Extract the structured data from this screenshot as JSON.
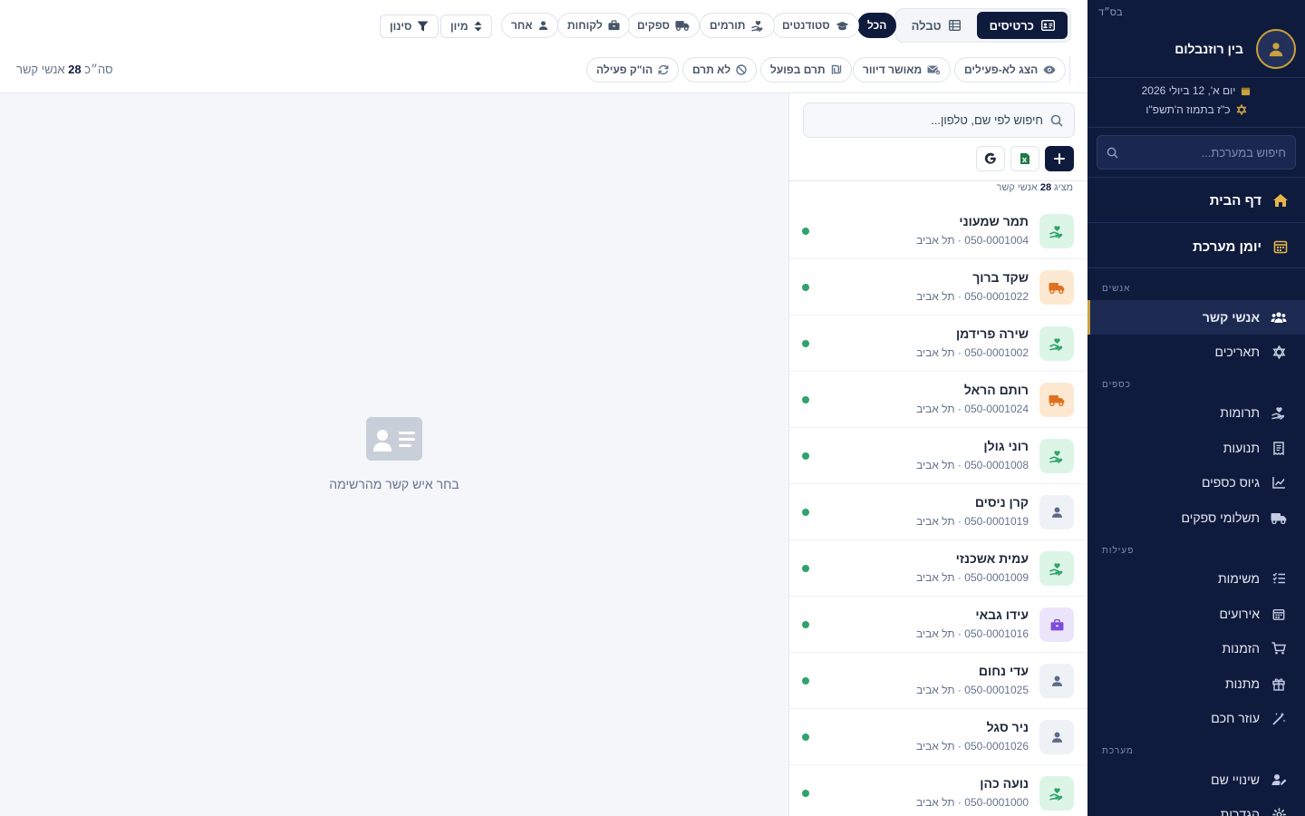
{
  "sidebar": {
    "top_label": "בס״ד",
    "username": "בין רוזנבלום",
    "date": "יום א', 12 ביולי 2026",
    "hebrew_date": "כ\"ז בתמוז ה'תשפ\"ו",
    "search_placeholder": "חיפוש במערכת...",
    "home": "דף הבית",
    "journal": "יומן מערכת",
    "sections": {
      "people": "אנשים",
      "money": "כספים",
      "activities": "פעילות",
      "system": "מערכת"
    },
    "items": {
      "contacts": "אנשי קשר",
      "dates": "תאריכים",
      "donations": "תרומות",
      "transactions": "תנועות",
      "fundraising": "גיוס כספים",
      "supplier_payments": "תשלומי ספקים",
      "tasks": "משימות",
      "events": "אירועים",
      "orders": "הזמנות",
      "gifts": "מתנות",
      "smart_helper": "עוזר חכם",
      "name_changes": "שינויי שם",
      "settings": "הגדרות"
    }
  },
  "topbar": {
    "view_cards": "כרטיסים",
    "view_table": "טבלה",
    "types": {
      "all": "הכל",
      "students": "סטודנטים",
      "donors": "תורמים",
      "suppliers": "ספקים",
      "customers": "לקוחות",
      "other": "אחר"
    },
    "sort": "מיון",
    "filter": "סינון",
    "chips": {
      "show_inactive": "הצג לא-פעילים",
      "mail_approved": "מאושר דיוור",
      "donated": "תרם בפועל",
      "not_donated": "לא תרם",
      "standing_order": "הו\"ק פעילה"
    },
    "total_prefix": "סה״כ",
    "total_count": "28",
    "total_suffix": "אנשי קשר"
  },
  "list": {
    "search_placeholder": "חיפוש לפי שם, טלפון...",
    "count_prefix": "מציג",
    "count": "28",
    "count_suffix": "אנשי קשר",
    "contacts": [
      {
        "name": "תמר שמעוני",
        "sub": "050-0001004 · תל אביב",
        "type": "donor"
      },
      {
        "name": "שקד ברוך",
        "sub": "050-0001022 · תל אביב",
        "type": "supplier"
      },
      {
        "name": "שירה פרידמן",
        "sub": "050-0001002 · תל אביב",
        "type": "donor"
      },
      {
        "name": "רותם הראל",
        "sub": "050-0001024 · תל אביב",
        "type": "supplier"
      },
      {
        "name": "רוני גולן",
        "sub": "050-0001008 · תל אביב",
        "type": "donor"
      },
      {
        "name": "קרן ניסים",
        "sub": "050-0001019 · תל אביב",
        "type": "other"
      },
      {
        "name": "עמית אשכנזי",
        "sub": "050-0001009 · תל אביב",
        "type": "donor"
      },
      {
        "name": "עידו גבאי",
        "sub": "050-0001016 · תל אביב",
        "type": "customer"
      },
      {
        "name": "עדי נחום",
        "sub": "050-0001025 · תל אביב",
        "type": "other"
      },
      {
        "name": "ניר סגל",
        "sub": "050-0001026 · תל אביב",
        "type": "other"
      },
      {
        "name": "נועה כהן",
        "sub": "050-0001000 · תל אביב",
        "type": "donor"
      }
    ]
  },
  "empty_state": {
    "text": "בחר איש קשר מהרשימה"
  },
  "colors": {
    "navy": "#0f1b3d",
    "gold": "#c9a13c",
    "active_green": "#2fa36b",
    "donor_bg": "#dcf5e7",
    "donor_fg": "#2fa36b",
    "supplier_bg": "#fde8d2",
    "supplier_fg": "#e0701f",
    "customer_bg": "#ebe5fb",
    "customer_fg": "#7c4ddb",
    "other_bg": "#eef1f6",
    "other_fg": "#5b6b86"
  }
}
